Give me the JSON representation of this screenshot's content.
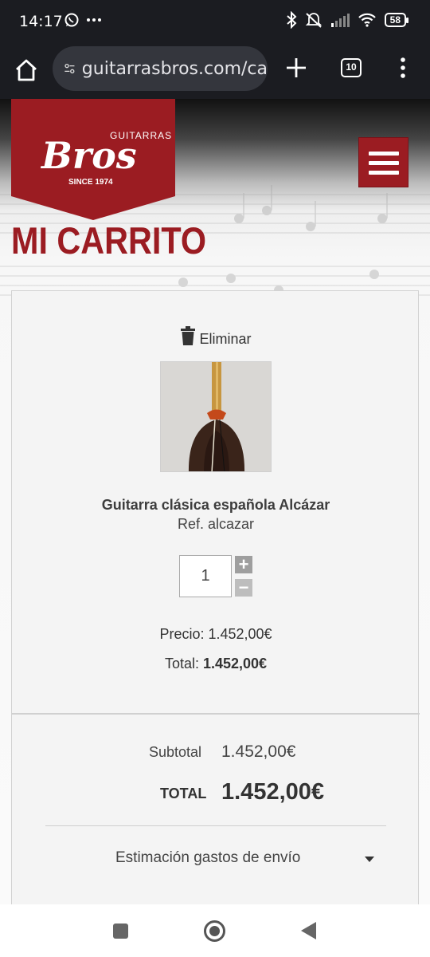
{
  "status_bar": {
    "time": "14:17",
    "battery": "58",
    "icons": [
      "whatsapp-icon",
      "more-icon",
      "bluetooth-icon",
      "mute-icon",
      "signal-icon",
      "wifi-icon",
      "battery-icon"
    ]
  },
  "browser": {
    "url": "guitarrasbros.com/ca",
    "tab_count": "10"
  },
  "header": {
    "logo_top": "GUITARRAS",
    "logo_main": "Bros",
    "logo_since": "SINCE 1974",
    "brand_color": "#9b1c22"
  },
  "page": {
    "title": "MI CARRITO"
  },
  "cart_item": {
    "delete_label": "Eliminar",
    "name": "Guitarra clásica española Alcázar",
    "ref": "Ref. alcazar",
    "quantity": "1",
    "plus": "+",
    "minus": "−",
    "price_label": "Precio: 1.452,00€",
    "total_label": "Total:",
    "total_value": "1.452,00€"
  },
  "summary": {
    "subtotal_label": "Subtotal",
    "subtotal_value": "1.452,00€",
    "total_label": "TOTAL",
    "total_value": "1.452,00€",
    "shipping_label": "Estimación gastos de envío"
  }
}
